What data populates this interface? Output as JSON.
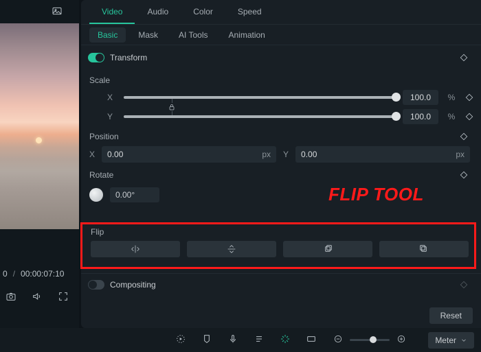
{
  "preview": {
    "time_current": "0",
    "time_total": "00:00:07:10"
  },
  "main_tabs": [
    "Video",
    "Audio",
    "Color",
    "Speed"
  ],
  "main_tab_active": 0,
  "sub_tabs": [
    "Basic",
    "Mask",
    "AI Tools",
    "Animation"
  ],
  "sub_tab_active": 0,
  "transform": {
    "label": "Transform",
    "enabled": true,
    "scale": {
      "label": "Scale",
      "x_label": "X",
      "x_value": "100.0",
      "x_unit": "%",
      "y_label": "Y",
      "y_value": "100.0",
      "y_unit": "%"
    },
    "position": {
      "label": "Position",
      "x_label": "X",
      "x_value": "0.00",
      "x_unit": "px",
      "y_label": "Y",
      "y_value": "0.00",
      "y_unit": "px"
    },
    "rotate": {
      "label": "Rotate",
      "value": "0.00°"
    },
    "flip": {
      "label": "Flip",
      "buttons": [
        "flip-horizontal",
        "flip-vertical",
        "rotate-cw",
        "rotate-ccw"
      ]
    }
  },
  "compositing": {
    "label": "Compositing",
    "enabled": false
  },
  "reset_label": "Reset",
  "annotation": "FLIP TOOL",
  "bottom": {
    "meter_label": "Meter"
  }
}
